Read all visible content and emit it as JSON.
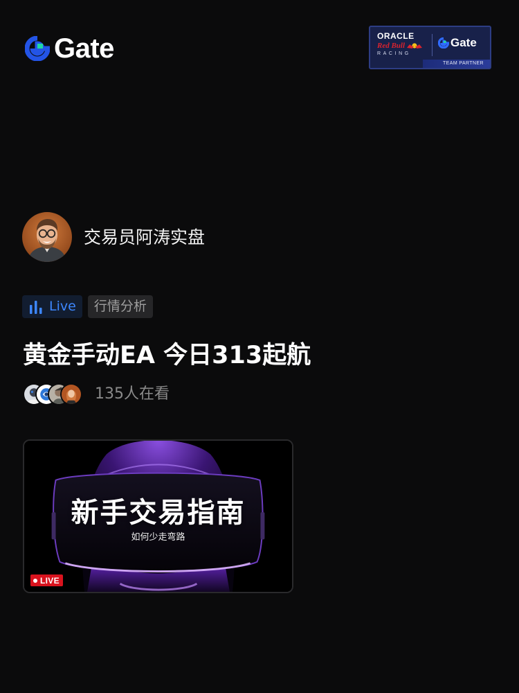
{
  "brand": {
    "name": "Gate",
    "icon": "gate-logo-icon",
    "accent": "#2354e6",
    "accent_secondary": "#20d7a4"
  },
  "partner_badge": {
    "oracle": "ORACLE",
    "redbull": "Red Bull",
    "racing": "RACING",
    "gate": "Gate",
    "caption": "TEAM PARTNER"
  },
  "host": {
    "name": "交易员阿涛实盘"
  },
  "tags": {
    "live_label": "Live",
    "live_icon": "bar-chart-icon",
    "category": "行情分析",
    "live_color": "#3d87ff"
  },
  "stream": {
    "title": "黄金手动EA 今日313起航"
  },
  "viewers": {
    "count_text": "135人在看",
    "avatar_count": 4
  },
  "cover": {
    "title": "新手交易指南",
    "subtitle": "如何少走弯路",
    "live_badge": "LIVE",
    "live_color": "#d9131e"
  }
}
